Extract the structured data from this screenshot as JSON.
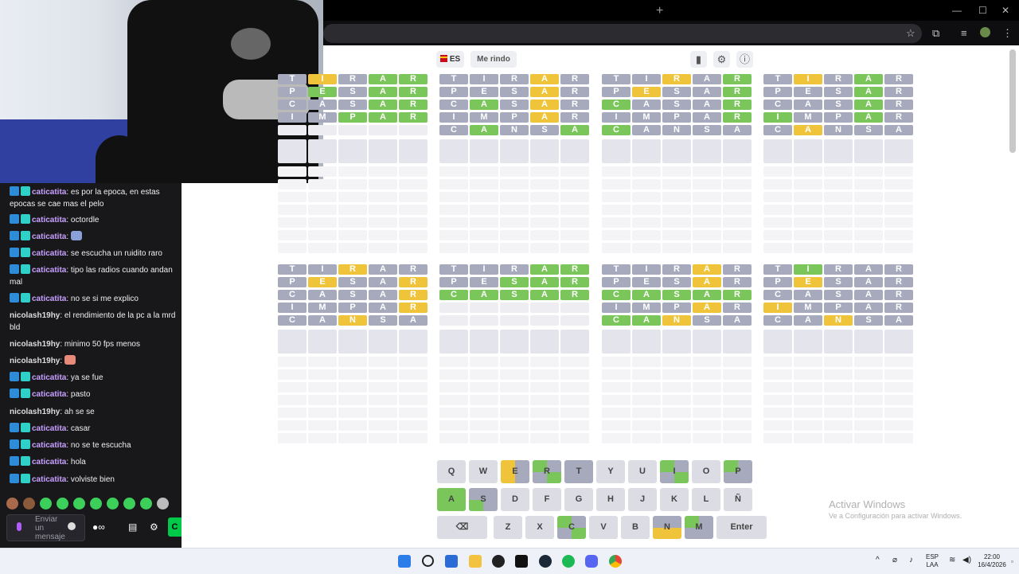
{
  "game": {
    "lang_label": "ES",
    "give_up_label": "Me rindo"
  },
  "boards": [
    {
      "rows": [
        {
          "letters": [
            "T",
            "I",
            "R",
            "A",
            "R"
          ],
          "states": [
            "x",
            "y",
            "x",
            "g",
            "g"
          ]
        },
        {
          "letters": [
            "P",
            "E",
            "S",
            "A",
            "R"
          ],
          "states": [
            "x",
            "g",
            "x",
            "g",
            "g"
          ]
        },
        {
          "letters": [
            "C",
            "A",
            "S",
            "A",
            "R"
          ],
          "states": [
            "x",
            "x",
            "x",
            "g",
            "g"
          ]
        },
        {
          "letters": [
            "I",
            "M",
            "P",
            "A",
            "R"
          ],
          "states": [
            "x",
            "x",
            "g",
            "g",
            "g"
          ]
        },
        {
          "letters": [
            "",
            "",
            "",
            "",
            ""
          ],
          "states": [
            "",
            "",
            "",
            "",
            ""
          ]
        }
      ]
    },
    {
      "rows": [
        {
          "letters": [
            "T",
            "I",
            "R",
            "A",
            "R"
          ],
          "states": [
            "x",
            "x",
            "x",
            "y",
            "x"
          ]
        },
        {
          "letters": [
            "P",
            "E",
            "S",
            "A",
            "R"
          ],
          "states": [
            "x",
            "x",
            "x",
            "y",
            "x"
          ]
        },
        {
          "letters": [
            "C",
            "A",
            "S",
            "A",
            "R"
          ],
          "states": [
            "x",
            "g",
            "x",
            "y",
            "x"
          ]
        },
        {
          "letters": [
            "I",
            "M",
            "P",
            "A",
            "R"
          ],
          "states": [
            "x",
            "x",
            "x",
            "y",
            "x"
          ]
        },
        {
          "letters": [
            "C",
            "A",
            "N",
            "S",
            "A"
          ],
          "states": [
            "x",
            "g",
            "x",
            "x",
            "g"
          ]
        }
      ]
    },
    {
      "rows": [
        {
          "letters": [
            "T",
            "I",
            "R",
            "A",
            "R"
          ],
          "states": [
            "x",
            "x",
            "y",
            "x",
            "g"
          ]
        },
        {
          "letters": [
            "P",
            "E",
            "S",
            "A",
            "R"
          ],
          "states": [
            "x",
            "y",
            "x",
            "x",
            "g"
          ]
        },
        {
          "letters": [
            "C",
            "A",
            "S",
            "A",
            "R"
          ],
          "states": [
            "g",
            "x",
            "x",
            "x",
            "g"
          ]
        },
        {
          "letters": [
            "I",
            "M",
            "P",
            "A",
            "R"
          ],
          "states": [
            "x",
            "x",
            "x",
            "x",
            "g"
          ]
        },
        {
          "letters": [
            "C",
            "A",
            "N",
            "S",
            "A"
          ],
          "states": [
            "g",
            "x",
            "x",
            "x",
            "x"
          ]
        }
      ]
    },
    {
      "rows": [
        {
          "letters": [
            "T",
            "I",
            "R",
            "A",
            "R"
          ],
          "states": [
            "x",
            "y",
            "x",
            "g",
            "x"
          ]
        },
        {
          "letters": [
            "P",
            "E",
            "S",
            "A",
            "R"
          ],
          "states": [
            "x",
            "x",
            "x",
            "g",
            "x"
          ]
        },
        {
          "letters": [
            "C",
            "A",
            "S",
            "A",
            "R"
          ],
          "states": [
            "x",
            "x",
            "x",
            "g",
            "x"
          ]
        },
        {
          "letters": [
            "I",
            "M",
            "P",
            "A",
            "R"
          ],
          "states": [
            "g",
            "x",
            "x",
            "g",
            "x"
          ]
        },
        {
          "letters": [
            "C",
            "A",
            "N",
            "S",
            "A"
          ],
          "states": [
            "x",
            "y",
            "x",
            "x",
            "x"
          ]
        }
      ]
    },
    {
      "rows": [
        {
          "letters": [
            "T",
            "I",
            "R",
            "A",
            "R"
          ],
          "states": [
            "x",
            "x",
            "y",
            "x",
            "x"
          ]
        },
        {
          "letters": [
            "P",
            "E",
            "S",
            "A",
            "R"
          ],
          "states": [
            "x",
            "y",
            "x",
            "x",
            "y"
          ]
        },
        {
          "letters": [
            "C",
            "A",
            "S",
            "A",
            "R"
          ],
          "states": [
            "x",
            "x",
            "x",
            "x",
            "y"
          ]
        },
        {
          "letters": [
            "I",
            "M",
            "P",
            "A",
            "R"
          ],
          "states": [
            "x",
            "x",
            "x",
            "x",
            "y"
          ]
        },
        {
          "letters": [
            "C",
            "A",
            "N",
            "S",
            "A"
          ],
          "states": [
            "x",
            "x",
            "y",
            "x",
            "x"
          ]
        }
      ]
    },
    {
      "rows": [
        {
          "letters": [
            "T",
            "I",
            "R",
            "A",
            "R"
          ],
          "states": [
            "x",
            "x",
            "x",
            "g",
            "g"
          ]
        },
        {
          "letters": [
            "P",
            "E",
            "S",
            "A",
            "R"
          ],
          "states": [
            "x",
            "x",
            "g",
            "g",
            "g"
          ]
        },
        {
          "letters": [
            "C",
            "A",
            "S",
            "A",
            "R"
          ],
          "states": [
            "g",
            "g",
            "g",
            "g",
            "g"
          ]
        },
        {
          "letters": [
            "",
            "",
            "",
            "",
            ""
          ],
          "states": [
            "",
            "",
            "",
            "",
            ""
          ]
        },
        {
          "letters": [
            "",
            "",
            "",
            "",
            ""
          ],
          "states": [
            "",
            "",
            "",
            "",
            ""
          ]
        }
      ]
    },
    {
      "rows": [
        {
          "letters": [
            "T",
            "I",
            "R",
            "A",
            "R"
          ],
          "states": [
            "x",
            "x",
            "x",
            "y",
            "x"
          ]
        },
        {
          "letters": [
            "P",
            "E",
            "S",
            "A",
            "R"
          ],
          "states": [
            "x",
            "x",
            "x",
            "y",
            "x"
          ]
        },
        {
          "letters": [
            "C",
            "A",
            "S",
            "A",
            "R"
          ],
          "states": [
            "g",
            "g",
            "g",
            "g",
            "g"
          ]
        },
        {
          "letters": [
            "I",
            "M",
            "P",
            "A",
            "R"
          ],
          "states": [
            "x",
            "x",
            "x",
            "y",
            "x"
          ]
        },
        {
          "letters": [
            "C",
            "A",
            "N",
            "S",
            "A"
          ],
          "states": [
            "g",
            "g",
            "y",
            "x",
            "x"
          ]
        }
      ]
    },
    {
      "rows": [
        {
          "letters": [
            "T",
            "I",
            "R",
            "A",
            "R"
          ],
          "states": [
            "x",
            "g",
            "x",
            "x",
            "x"
          ]
        },
        {
          "letters": [
            "P",
            "E",
            "S",
            "A",
            "R"
          ],
          "states": [
            "x",
            "y",
            "x",
            "x",
            "x"
          ]
        },
        {
          "letters": [
            "C",
            "A",
            "S",
            "A",
            "R"
          ],
          "states": [
            "x",
            "x",
            "x",
            "x",
            "x"
          ]
        },
        {
          "letters": [
            "I",
            "M",
            "P",
            "A",
            "R"
          ],
          "states": [
            "y",
            "x",
            "x",
            "x",
            "x"
          ]
        },
        {
          "letters": [
            "C",
            "A",
            "N",
            "S",
            "A"
          ],
          "states": [
            "x",
            "x",
            "y",
            "x",
            "x"
          ]
        }
      ]
    }
  ],
  "keyboard": [
    [
      {
        "k": "Q",
        "q": [
          "",
          "",
          "",
          ""
        ]
      },
      {
        "k": "W",
        "q": [
          "",
          "",
          "",
          ""
        ]
      },
      {
        "k": "E",
        "q": [
          "y",
          "x",
          "y",
          "x"
        ]
      },
      {
        "k": "R",
        "q": [
          "g",
          "x",
          "x",
          "g"
        ]
      },
      {
        "k": "T",
        "q": [
          "x",
          "x",
          "x",
          "x"
        ]
      },
      {
        "k": "Y",
        "q": [
          "",
          "",
          "",
          ""
        ]
      },
      {
        "k": "U",
        "q": [
          "",
          "",
          "",
          ""
        ]
      },
      {
        "k": "I",
        "q": [
          "g",
          "x",
          "x",
          "g"
        ]
      },
      {
        "k": "O",
        "q": [
          "",
          "",
          "",
          ""
        ]
      },
      {
        "k": "P",
        "q": [
          "g",
          "x",
          "x",
          "x"
        ]
      }
    ],
    [
      {
        "k": "A",
        "q": [
          "g",
          "g",
          "g",
          "g"
        ]
      },
      {
        "k": "S",
        "q": [
          "x",
          "x",
          "g",
          "x"
        ]
      },
      {
        "k": "D",
        "q": [
          "",
          "",
          "",
          ""
        ]
      },
      {
        "k": "F",
        "q": [
          "",
          "",
          "",
          ""
        ]
      },
      {
        "k": "G",
        "q": [
          "",
          "",
          "",
          ""
        ]
      },
      {
        "k": "H",
        "q": [
          "",
          "",
          "",
          ""
        ]
      },
      {
        "k": "J",
        "q": [
          "",
          "",
          "",
          ""
        ]
      },
      {
        "k": "K",
        "q": [
          "",
          "",
          "",
          ""
        ]
      },
      {
        "k": "L",
        "q": [
          "",
          "",
          "",
          ""
        ]
      },
      {
        "k": "Ñ",
        "q": [
          "",
          "",
          "",
          ""
        ]
      }
    ],
    [
      {
        "k": "⌫",
        "wide": true,
        "q": [
          "",
          "",
          "",
          ""
        ]
      },
      {
        "k": "Z",
        "q": [
          "",
          "",
          "",
          ""
        ]
      },
      {
        "k": "X",
        "q": [
          "",
          "",
          "",
          ""
        ]
      },
      {
        "k": "C",
        "q": [
          "g",
          "x",
          "x",
          "g"
        ]
      },
      {
        "k": "V",
        "q": [
          "",
          "",
          "",
          ""
        ]
      },
      {
        "k": "B",
        "q": [
          "",
          "",
          "",
          ""
        ]
      },
      {
        "k": "N",
        "q": [
          "x",
          "x",
          "y",
          "y"
        ]
      },
      {
        "k": "M",
        "q": [
          "g",
          "x",
          "x",
          "x"
        ]
      },
      {
        "k": "Enter",
        "wide": true,
        "q": [
          "",
          "",
          "",
          ""
        ]
      }
    ]
  ],
  "chat": {
    "lines": [
      {
        "badges": true,
        "user": "caticatita",
        "text": "es por la epoca, en estas epocas se cae mas el pelo"
      },
      {
        "badges": true,
        "user": "caticatita",
        "text": "octordle"
      },
      {
        "badges": true,
        "user": "caticatita",
        "text": "",
        "emote": true
      },
      {
        "badges": true,
        "user": "caticatita",
        "text": "se escucha un ruidito raro"
      },
      {
        "badges": true,
        "user": "caticatita",
        "text": "tipo las radios cuando andan mal"
      },
      {
        "badges": true,
        "user": "caticatita",
        "text": "no se si me explico"
      },
      {
        "badges": false,
        "user": "nicolash19hy",
        "text": "el rendimiento de la pc a la mrd bld"
      },
      {
        "badges": false,
        "user": "nicolash19hy",
        "text": "minimo 50 fps menos"
      },
      {
        "badges": false,
        "user": "nicolash19hy",
        "text": "",
        "emote": true
      },
      {
        "badges": true,
        "user": "caticatita",
        "text": "ya se fue"
      },
      {
        "badges": true,
        "user": "caticatita",
        "text": "pasto"
      },
      {
        "badges": false,
        "user": "nicolash19hy",
        "text": "ah se se"
      },
      {
        "badges": true,
        "user": "caticatita",
        "text": "casar"
      },
      {
        "badges": true,
        "user": "caticatita",
        "text": "no se te escucha"
      },
      {
        "badges": true,
        "user": "caticatita",
        "text": "hola"
      },
      {
        "badges": true,
        "user": "caticatita",
        "text": "volviste bien"
      }
    ],
    "input_placeholder": "Enviar un mensaje",
    "send_label": "C"
  },
  "windows": {
    "activate_title": "Activar Windows",
    "activate_sub": "Ve a Configuración para activar Windows."
  },
  "tray": {
    "lang_top": "ESP",
    "lang_bottom": "LAA",
    "time": "22:00",
    "date": "16/4/2026"
  },
  "colors": {
    "green": "#7ac65a",
    "yellow": "#f0c43a",
    "gray": "#a7aabd"
  }
}
